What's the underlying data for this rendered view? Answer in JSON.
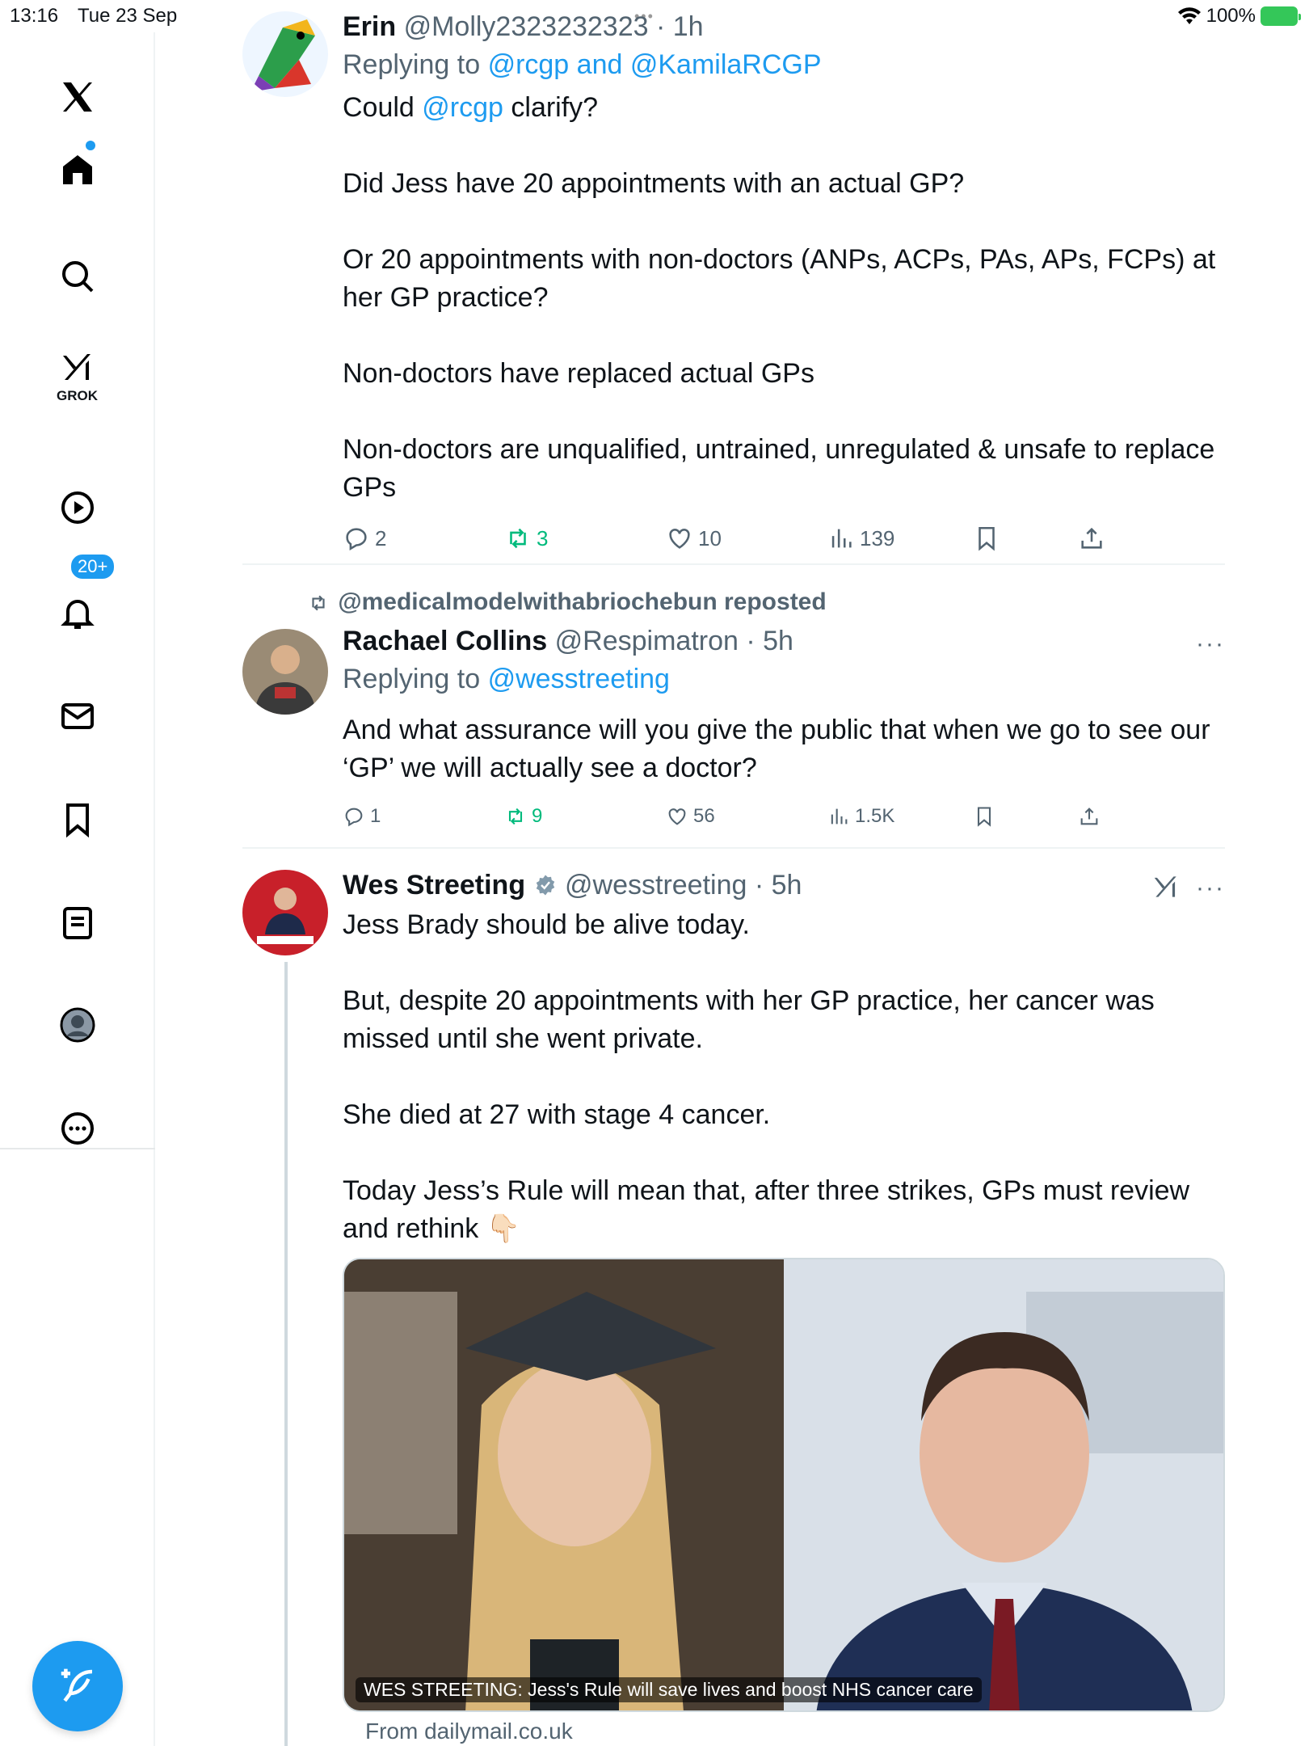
{
  "status": {
    "time": "13:16",
    "date": "Tue 23 Sep",
    "battery": "100%"
  },
  "sidebar": {
    "grok_label": "GROK",
    "notifications_badge": "20+",
    "items": [
      "x-logo",
      "home-icon",
      "search-icon",
      "grok-icon",
      "video-icon",
      "notifications-icon",
      "messages-icon",
      "bookmarks-icon",
      "lists-icon",
      "profile-icon",
      "more-icon"
    ]
  },
  "tweets": [
    {
      "name": "Erin",
      "handle": "@Molly2323232323",
      "time": "· 1h",
      "reply_prefix": "Replying to",
      "reply_to": "@rcgp and @KamilaRCGP",
      "text_pre": "Could ",
      "text_mention": "@rcgp",
      "text_post": " clarify?\n\nDid Jess have 20 appointments with an actual GP?\n\nOr 20 appointments with non-doctors (ANPs, ACPs, PAs, APs, FCPs) at her GP practice?\n\nNon-doctors have replaced actual GPs\n\nNon-doctors are unqualified, untrained, unregulated & unsafe to replace GPs",
      "replies": "2",
      "reposts": "3",
      "likes": "10",
      "views": "139"
    },
    {
      "repost_by": "@medicalmodelwithabriochebun reposted",
      "name": "Rachael Collins",
      "handle": "@Respimatron",
      "time": "· 5h",
      "reply_prefix": "Replying to",
      "reply_to": "@wesstreeting",
      "text": "And what assurance will you give the public that when we go to see our ‘GP’ we will actually see a doctor?",
      "replies": "1",
      "reposts": "9",
      "likes": "56",
      "views": "1.5K",
      "more": "···"
    },
    {
      "name": "Wes Streeting",
      "handle": "@wesstreeting",
      "time": "· 5h",
      "text": "Jess Brady should be alive today.\n\nBut, despite 20 appointments with her GP practice, her cancer was missed until she went private.\n\nShe died at 27 with stage 4 cancer.\n\nToday Jess’s Rule will mean that, after three strikes, GPs must review and rethink 👇🏻",
      "media_caption": "WES STREETING: Jess's Rule will save lives and boost NHS cancer care",
      "from": "From dailymail.co.uk",
      "more": "···"
    }
  ],
  "colors": {
    "accent": "#1d9bf0",
    "repost": "#00ba7c",
    "muted": "#536471"
  }
}
